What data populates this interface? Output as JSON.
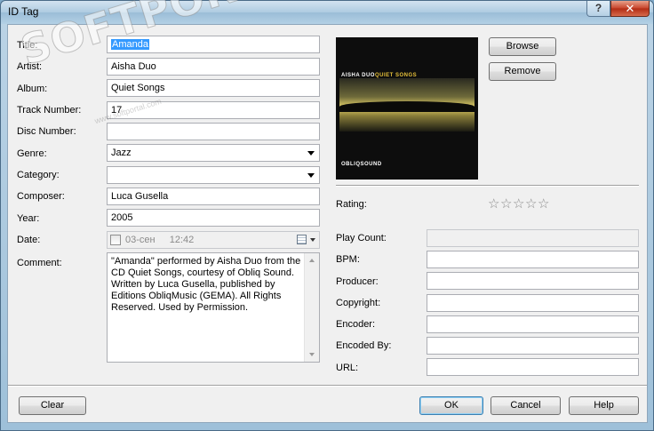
{
  "window": {
    "title": "ID Tag",
    "help_glyph": "?",
    "close_glyph": "✕"
  },
  "watermark": {
    "text": "SOFTPORTAL",
    "trademark": "™",
    "sub": "www.softportal.com"
  },
  "left_fields": {
    "title": {
      "label": "Title:",
      "value": "Amanda"
    },
    "artist": {
      "label": "Artist:",
      "value": "Aisha Duo"
    },
    "album": {
      "label": "Album:",
      "value": "Quiet Songs"
    },
    "track_number": {
      "label": "Track Number:",
      "value": "17"
    },
    "disc_number": {
      "label": "Disc Number:",
      "value": ""
    },
    "genre": {
      "label": "Genre:",
      "value": "Jazz"
    },
    "category": {
      "label": "Category:",
      "value": ""
    },
    "composer": {
      "label": "Composer:",
      "value": "Luca Gusella"
    },
    "year": {
      "label": "Year:",
      "value": "2005"
    },
    "date": {
      "label": "Date:",
      "day": "03-сен",
      "time": "12:42"
    },
    "comment": {
      "label": "Comment:",
      "value": "\"Amanda\" performed by Aisha Duo from the CD Quiet Songs, courtesy of Obliq Sound. Written by Luca Gusella, published by Editions ObliqMusic (GEMA).  All Rights Reserved.  Used by Permission."
    }
  },
  "artwork": {
    "artist_text": "AISHA DUO",
    "album_text": "QUIET SONGS",
    "label_text": "OBLIQSOUND"
  },
  "artwork_buttons": {
    "browse": "Browse",
    "remove": "Remove"
  },
  "rating": {
    "label": "Rating:",
    "value": 0,
    "max": 5,
    "star_glyph": "☆"
  },
  "right_fields": {
    "play_count": {
      "label": "Play Count:",
      "value": ""
    },
    "bpm": {
      "label": "BPM:",
      "value": ""
    },
    "producer": {
      "label": "Producer:",
      "value": ""
    },
    "copyright": {
      "label": "Copyright:",
      "value": ""
    },
    "encoder": {
      "label": "Encoder:",
      "value": ""
    },
    "encoded_by": {
      "label": "Encoded By:",
      "value": ""
    },
    "url": {
      "label": "URL:",
      "value": ""
    }
  },
  "footer": {
    "clear": "Clear",
    "ok": "OK",
    "cancel": "Cancel",
    "help": "Help"
  }
}
